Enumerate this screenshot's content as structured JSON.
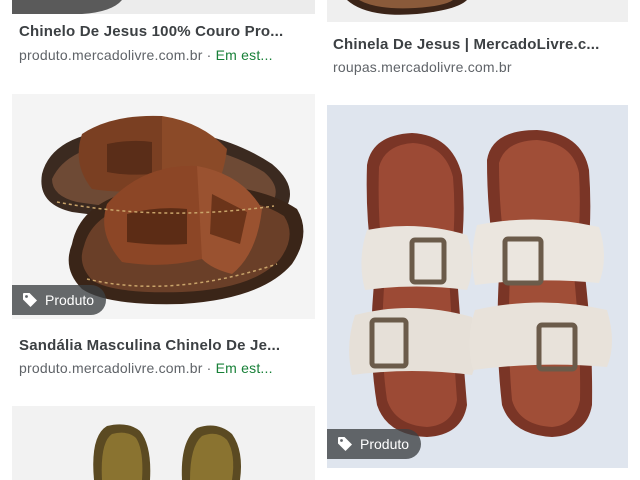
{
  "results": [
    {
      "title": "Chinelo De Jesus 100% Couro Pro...",
      "source": "produto.mercadolivre.com.br",
      "stock": "Em est..."
    },
    {
      "title": "Chinela De Jesus | MercadoLivre.c...",
      "source": "roupas.mercadolivre.com.br"
    },
    {
      "title": "Sandália Masculina Chinelo De Je...",
      "source": "produto.mercadolivre.com.br",
      "stock": "Em est...",
      "badge": "Produto"
    },
    {
      "badge": "Produto"
    }
  ],
  "separator": " · ",
  "colors": {
    "title": "#3c4043",
    "source": "#5f6368",
    "in_stock": "#188038",
    "badge_bg": "#3c4043"
  },
  "icons": [
    "tag-icon"
  ]
}
